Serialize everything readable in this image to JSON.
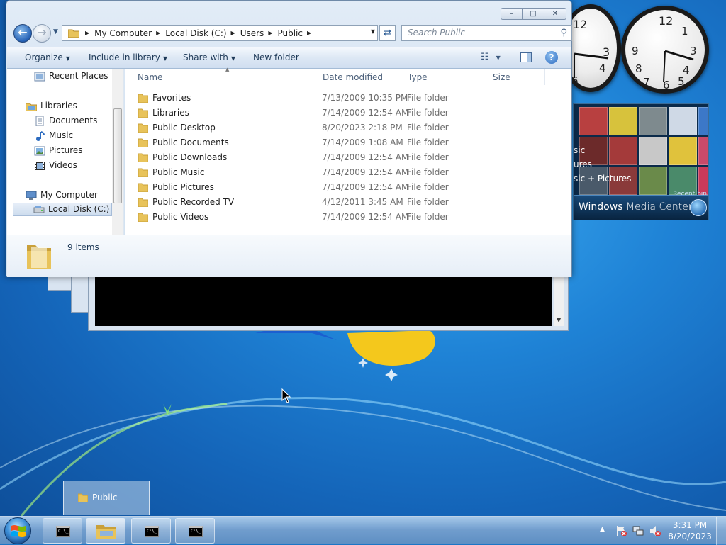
{
  "window": {
    "minimize_glyph": "–",
    "maximize_glyph": "□",
    "close_glyph": "✕"
  },
  "address_bar": {
    "crumbs": [
      "My Computer",
      "Local Disk (C:)",
      "Users",
      "Public"
    ],
    "search_placeholder": "Search Public"
  },
  "toolbar": {
    "organize": "Organize",
    "include_in_library": "Include in library",
    "share_with": "Share with",
    "new_folder": "New folder"
  },
  "nav_pane": {
    "items": [
      {
        "label": "Recent Places",
        "icon": "recent-places-icon"
      },
      {
        "label": "Libraries",
        "icon": "libraries-icon"
      },
      {
        "label": "Documents",
        "icon": "documents-icon"
      },
      {
        "label": "Music",
        "icon": "music-icon"
      },
      {
        "label": "Pictures",
        "icon": "pictures-icon"
      },
      {
        "label": "Videos",
        "icon": "videos-icon"
      },
      {
        "label": "My Computer",
        "icon": "computer-icon"
      },
      {
        "label": "Local Disk (C:)",
        "icon": "drive-icon",
        "selected": true
      }
    ]
  },
  "file_list": {
    "columns": [
      "Name",
      "Date modified",
      "Type",
      "Size"
    ],
    "rows": [
      {
        "name": "Favorites",
        "date": "7/13/2009 10:35 PM",
        "type": "File folder"
      },
      {
        "name": "Libraries",
        "date": "7/14/2009 12:54 AM",
        "type": "File folder"
      },
      {
        "name": "Public Desktop",
        "date": "8/20/2023 2:18 PM",
        "type": "File folder"
      },
      {
        "name": "Public Documents",
        "date": "7/14/2009 1:08 AM",
        "type": "File folder"
      },
      {
        "name": "Public Downloads",
        "date": "7/14/2009 12:54 AM",
        "type": "File folder"
      },
      {
        "name": "Public Music",
        "date": "7/14/2009 12:54 AM",
        "type": "File folder"
      },
      {
        "name": "Public Pictures",
        "date": "7/14/2009 12:54 AM",
        "type": "File folder"
      },
      {
        "name": "Public Recorded TV",
        "date": "4/12/2011 3:45 AM",
        "type": "File folder"
      },
      {
        "name": "Public Videos",
        "date": "7/14/2009 12:54 AM",
        "type": "File folder"
      }
    ]
  },
  "details_pane": {
    "item_count": "9 items"
  },
  "gadgets": {
    "media_center": {
      "brand_primary": "Windows",
      "brand_secondary": "Media Center",
      "menu_lines": [
        "sic",
        "ures",
        "sic + Pictures"
      ],
      "recent_label": "Recent bin"
    }
  },
  "taskbar": {
    "preview_label": "Public",
    "cmd_icon_text": "C:\\_",
    "clock_time": "3:31 PM",
    "clock_date": "8/20/2023"
  },
  "colors": {
    "folder": "#e8c35a",
    "folder_dark": "#c9a03a",
    "desktop": "#1f83d6"
  }
}
